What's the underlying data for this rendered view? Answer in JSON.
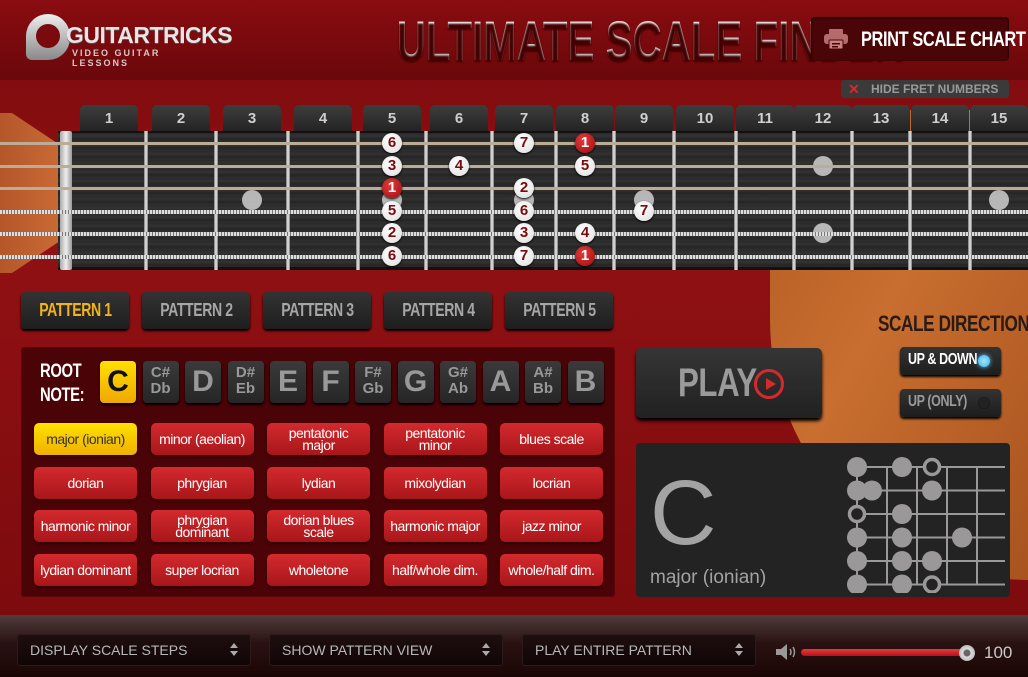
{
  "header": {
    "logo_brand": "GUITARTRICKS",
    "logo_sub": "VIDEO GUITAR LESSONS",
    "title": "ULTIMATE SCALE FINDER",
    "print_label": "PRINT SCALE CHART",
    "print_icon": "printer-icon",
    "hide_fret_label": "HIDE FRET NUMBERS",
    "hide_fret_icon": "close-icon"
  },
  "fretboard": {
    "fret_numbers": [
      "1",
      "2",
      "3",
      "4",
      "5",
      "6",
      "7",
      "8",
      "9",
      "10",
      "11",
      "12",
      "13",
      "14",
      "15"
    ],
    "inlay_frets": [
      3,
      5,
      7,
      9,
      12,
      12,
      15
    ],
    "notes": [
      {
        "string": 1,
        "fret": 5,
        "degree": "6",
        "root": false
      },
      {
        "string": 1,
        "fret": 7,
        "degree": "7",
        "root": false
      },
      {
        "string": 1,
        "fret": 8,
        "degree": "1",
        "root": true
      },
      {
        "string": 2,
        "fret": 5,
        "degree": "3",
        "root": false
      },
      {
        "string": 2,
        "fret": 6,
        "degree": "4",
        "root": false
      },
      {
        "string": 2,
        "fret": 8,
        "degree": "5",
        "root": false
      },
      {
        "string": 3,
        "fret": 5,
        "degree": "1",
        "root": true
      },
      {
        "string": 3,
        "fret": 7,
        "degree": "2",
        "root": false
      },
      {
        "string": 4,
        "fret": 5,
        "degree": "5",
        "root": false
      },
      {
        "string": 4,
        "fret": 7,
        "degree": "6",
        "root": false
      },
      {
        "string": 4,
        "fret": 9,
        "degree": "7",
        "root": false
      },
      {
        "string": 5,
        "fret": 5,
        "degree": "2",
        "root": false
      },
      {
        "string": 5,
        "fret": 7,
        "degree": "3",
        "root": false
      },
      {
        "string": 5,
        "fret": 8,
        "degree": "4",
        "root": false
      },
      {
        "string": 6,
        "fret": 5,
        "degree": "6",
        "root": false
      },
      {
        "string": 6,
        "fret": 7,
        "degree": "7",
        "root": false
      },
      {
        "string": 6,
        "fret": 8,
        "degree": "1",
        "root": true
      }
    ]
  },
  "patterns": {
    "active": 0,
    "tabs": [
      "PATTERN 1",
      "PATTERN 2",
      "PATTERN 3",
      "PATTERN 4",
      "PATTERN 5"
    ]
  },
  "root": {
    "label_line1": "ROOT",
    "label_line2": "NOTE:",
    "active": 0,
    "keys": [
      {
        "top": "C",
        "bottom": ""
      },
      {
        "top": "C#",
        "bottom": "Db"
      },
      {
        "top": "D",
        "bottom": ""
      },
      {
        "top": "D#",
        "bottom": "Eb"
      },
      {
        "top": "E",
        "bottom": ""
      },
      {
        "top": "F",
        "bottom": ""
      },
      {
        "top": "F#",
        "bottom": "Gb"
      },
      {
        "top": "G",
        "bottom": ""
      },
      {
        "top": "G#",
        "bottom": "Ab"
      },
      {
        "top": "A",
        "bottom": ""
      },
      {
        "top": "A#",
        "bottom": "Bb"
      },
      {
        "top": "B",
        "bottom": ""
      }
    ]
  },
  "scales": {
    "active": 0,
    "items": [
      [
        "major (ionian)",
        ""
      ],
      [
        "minor (aeolian)",
        ""
      ],
      [
        "pentatonic",
        "major"
      ],
      [
        "pentatonic",
        "minor"
      ],
      [
        "blues scale",
        ""
      ],
      [
        "dorian",
        ""
      ],
      [
        "phrygian",
        ""
      ],
      [
        "lydian",
        ""
      ],
      [
        "mixolydian",
        ""
      ],
      [
        "locrian",
        ""
      ],
      [
        "harmonic minor",
        ""
      ],
      [
        "phrygian",
        "dominant"
      ],
      [
        "dorian blues",
        "scale"
      ],
      [
        "harmonic major",
        ""
      ],
      [
        "jazz minor",
        ""
      ],
      [
        "lydian dominant",
        ""
      ],
      [
        "super locrian",
        ""
      ],
      [
        "wholetone",
        ""
      ],
      [
        "half/whole dim.",
        ""
      ],
      [
        "whole/half dim.",
        ""
      ]
    ]
  },
  "play": {
    "label": "PLAY",
    "icon": "play-circle-icon"
  },
  "direction": {
    "title": "SCALE DIRECTION",
    "options": [
      {
        "label": "UP & DOWN",
        "selected": true
      },
      {
        "label": "UP (ONLY)",
        "selected": false
      }
    ]
  },
  "info": {
    "note": "C",
    "scale": "major (ionian)",
    "diagram_dots": [
      {
        "row": 0,
        "col": 0,
        "open": false
      },
      {
        "row": 0,
        "col": 2,
        "open": false
      },
      {
        "row": 0,
        "col": 3,
        "open": true
      },
      {
        "row": 1,
        "col": 0,
        "open": false
      },
      {
        "row": 1,
        "col": 1,
        "open": false
      },
      {
        "row": 1,
        "col": 3,
        "open": false
      },
      {
        "row": 2,
        "col": 0,
        "open": true
      },
      {
        "row": 2,
        "col": 2,
        "open": false
      },
      {
        "row": 3,
        "col": 0,
        "open": false
      },
      {
        "row": 3,
        "col": 2,
        "open": false
      },
      {
        "row": 3,
        "col": 4,
        "open": false
      },
      {
        "row": 4,
        "col": 0,
        "open": false
      },
      {
        "row": 4,
        "col": 2,
        "open": false
      },
      {
        "row": 4,
        "col": 3,
        "open": false
      },
      {
        "row": 5,
        "col": 0,
        "open": false
      },
      {
        "row": 5,
        "col": 2,
        "open": false
      },
      {
        "row": 5,
        "col": 3,
        "open": true
      }
    ]
  },
  "bottom": {
    "display_select": "DISPLAY SCALE STEPS",
    "view_select": "SHOW PATTERN VIEW",
    "play_select": "PLAY ENTIRE PATTERN",
    "volume": 100,
    "volume_label": "100"
  },
  "colors": {
    "accent_yellow": "#f2b41a",
    "accent_red": "#d42a2a",
    "led_blue": "#3db4e8"
  }
}
